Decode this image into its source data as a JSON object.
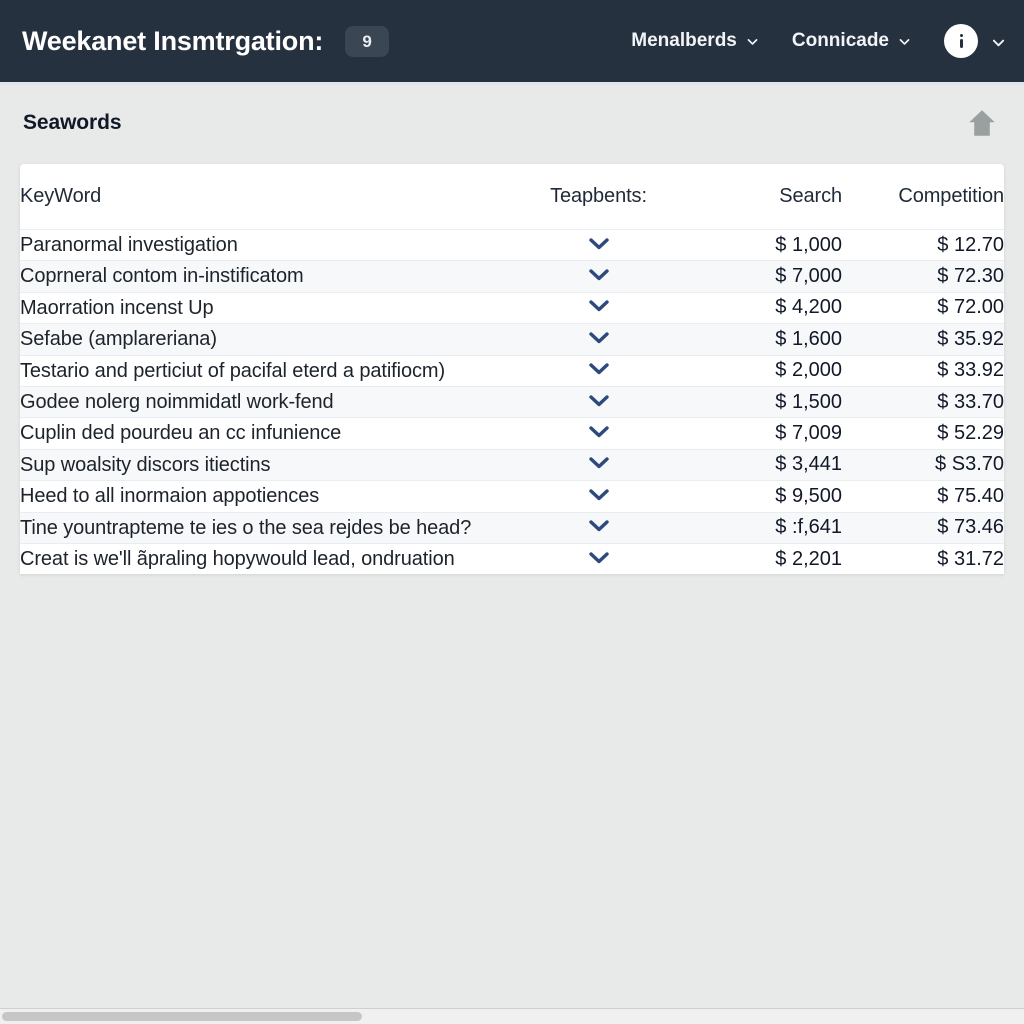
{
  "navbar": {
    "title": "Weekanet Insmtrgation:",
    "badge": "9",
    "links": [
      {
        "label": "Menalberds",
        "icon": "chevron-down-icon"
      },
      {
        "label": "Connicade",
        "icon": "chevron-down-icon"
      }
    ],
    "avatar_icon": "info-dots-icon",
    "avatar_chevron": "chevron-down-icon",
    "background_color": "#26313f",
    "text_color": "#ffffff"
  },
  "section": {
    "title": "Seawords",
    "home_icon": "home-icon",
    "home_icon_color": "#9aa0a0"
  },
  "table": {
    "columns": [
      {
        "key": "keyword",
        "label": "KeyWord",
        "align": "left"
      },
      {
        "key": "trend",
        "label": "Teapbents:",
        "align": "center"
      },
      {
        "key": "search",
        "label": "Search",
        "align": "right"
      },
      {
        "key": "competition",
        "label": "Competition",
        "align": "right"
      }
    ],
    "trend_icon": "chevron-down-icon",
    "trend_icon_color": "#2c4a7c",
    "rows": [
      {
        "keyword": "Paranormal investigation",
        "search": "$ 1,000",
        "competition": "$ 12.70"
      },
      {
        "keyword": "Coprneral contom in-instificatom",
        "search": "$ 7,000",
        "competition": "$ 72.30"
      },
      {
        "keyword": "Maorration incenst Up",
        "search": "$ 4,200",
        "competition": "$ 72.00"
      },
      {
        "keyword": "Sefabe (amplareriana)",
        "search": "$ 1,600",
        "competition": "$ 35.92"
      },
      {
        "keyword": "Testario and perticiut of pacifal eterd a patifiocm)",
        "search": "$ 2,000",
        "competition": "$ 33.92"
      },
      {
        "keyword": "Godee nolerg noimmidatl work-fend",
        "search": "$ 1,500",
        "competition": "$ 33.70"
      },
      {
        "keyword": "Cuplin ded pourdeu an cc infunience",
        "search": "$ 7,009",
        "competition": "$ 52.29"
      },
      {
        "keyword": "Sup woalsity discors itiectins",
        "search": "$ 3,441",
        "competition": "$ S3.70"
      },
      {
        "keyword": "Heed to all inormaion appotiences",
        "search": "$ 9,500",
        "competition": "$ 75.40"
      },
      {
        "keyword": "Tine yountrapteme te ies o the sea rejdes be head?",
        "search": "$ :f,641",
        "competition": "$ 73.46"
      },
      {
        "keyword": "Creat is we'll ãpraling hopywould lead, ondruation",
        "search": "$ 2,201",
        "competition": "$ 31.72"
      }
    ]
  }
}
